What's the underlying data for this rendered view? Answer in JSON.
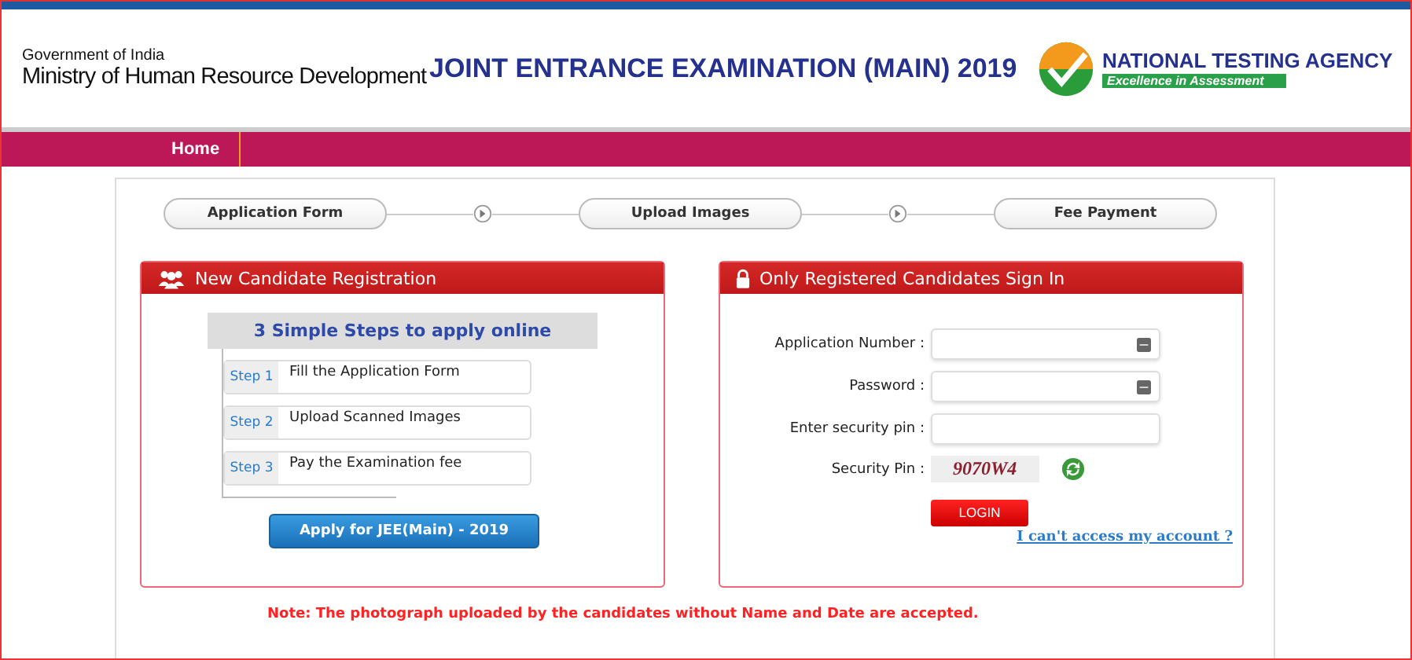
{
  "header": {
    "gov_line": "Government of India",
    "ministry": "Ministry of Human Resource Development",
    "title": "JOINT ENTRANCE EXAMINATION (MAIN) 2019",
    "agency": "NATIONAL TESTING AGENCY",
    "agency_tagline": "Excellence in Assessment"
  },
  "nav": [
    {
      "label": "Home",
      "selected": true
    }
  ],
  "stepper": [
    "Application Form",
    "Upload Images",
    "Fee Payment"
  ],
  "registration": {
    "title": "New Candidate Registration",
    "steps_title": "3 Simple Steps to apply online",
    "steps": [
      {
        "tag": "Step 1",
        "text": "Fill the Application Form"
      },
      {
        "tag": "Step 2",
        "text": "Upload Scanned Images"
      },
      {
        "tag": "Step 3",
        "text": "Pay the Examination fee"
      }
    ],
    "apply_button": "Apply for JEE(Main) - 2019"
  },
  "signin": {
    "title": "Only Registered Candidates Sign In",
    "fields": [
      {
        "label": "Application Number :",
        "keypad": true
      },
      {
        "label": "Password :",
        "keypad": true
      },
      {
        "label": "Enter security pin :",
        "keypad": false
      }
    ],
    "captcha_label": "Security Pin :",
    "captcha": "9070W4",
    "login_button": "LOGIN",
    "help_link": "I can't access my account ?"
  },
  "note": "Note: The photograph uploaded by the candidates without Name and Date are accepted."
}
